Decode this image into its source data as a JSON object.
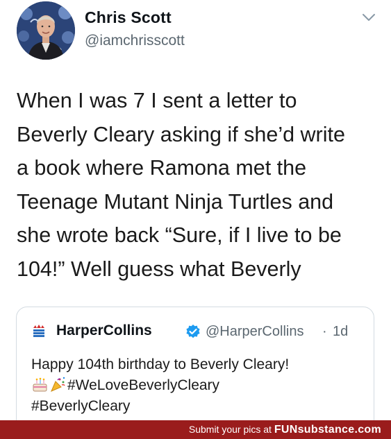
{
  "tweet": {
    "author_name": "Chris Scott",
    "author_handle": "@iamchrisscott",
    "menu_icon": "chevron-down-icon",
    "text_lines": [
      "When I was 7 I sent a letter to",
      "Beverly Cleary asking if she’d write",
      "a book where Ramona met the",
      "Teenage Mutant Ninja Turtles and",
      "she wrote back “Sure, if I live to be",
      "104!” Well guess what Beverly"
    ]
  },
  "quoted_tweet": {
    "author_name": "HarperCollins",
    "verified_icon": "verified-badge-icon",
    "author_handle": "@HarperCollins",
    "separator": "·",
    "time": "1d",
    "line1": "Happy 104th birthday to Beverly Cleary!",
    "emoji_1": "birthday-cake-emoji",
    "emoji_2": "party-popper-emoji",
    "hashtag_1": "#WeLoveBeverlyCleary",
    "hashtag_2": "#BeverlyCleary"
  },
  "watermark": {
    "text": "Submit your pics at",
    "brand": "FUNsubstance.com"
  },
  "colors": {
    "watermark_bg": "#9a1c1c",
    "verified_blue": "#1d9bf0",
    "handle_gray": "#5b6770"
  }
}
